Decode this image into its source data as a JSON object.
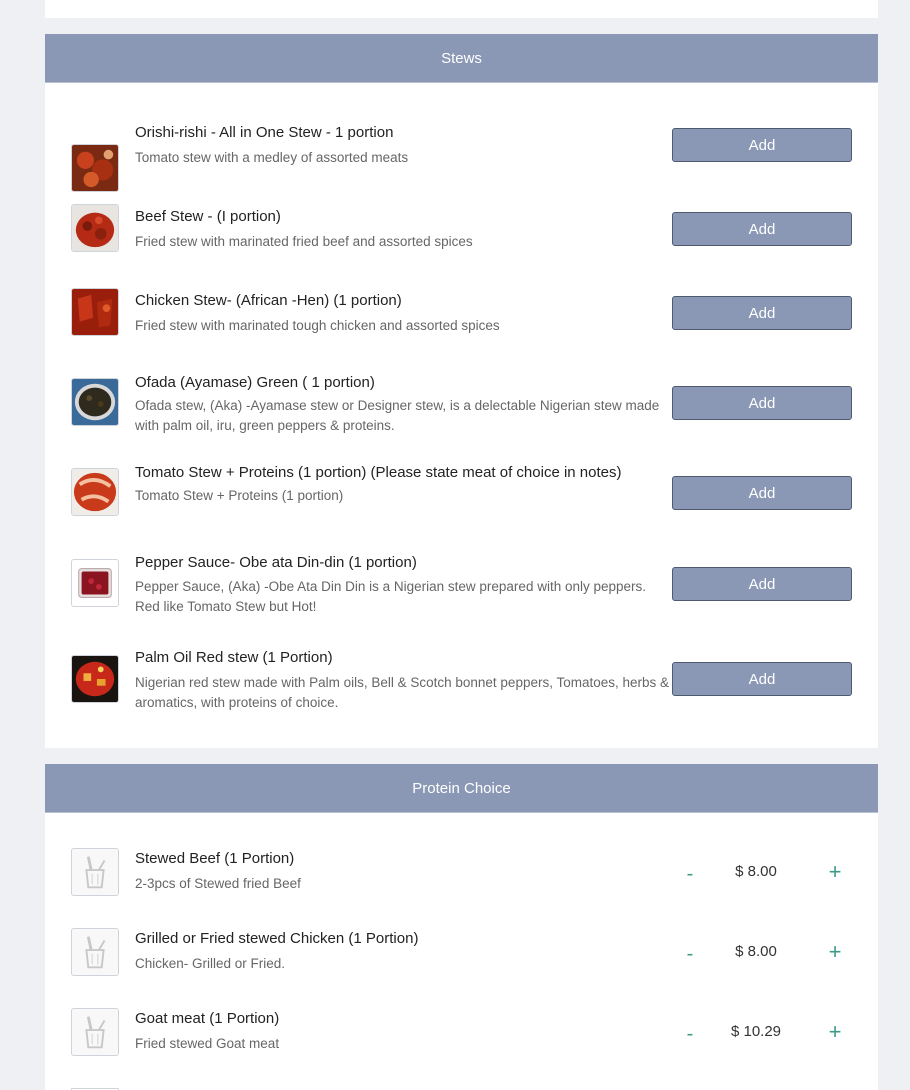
{
  "stews": {
    "header": "Stews",
    "items": [
      {
        "title": "Orishi-rishi - All in One Stew - 1 portion",
        "desc": "Tomato stew with a medley of assorted meats",
        "button": "Add"
      },
      {
        "title": "Beef Stew - (I portion)",
        "desc": "Fried stew with marinated fried beef and assorted spices",
        "button": "Add"
      },
      {
        "title": "Chicken Stew- (African -Hen) (1 portion)",
        "desc": "Fried stew with marinated tough chicken and assorted spices",
        "button": "Add"
      },
      {
        "title": "Ofada (Ayamase) Green ( 1 portion)",
        "desc": "Ofada stew, (Aka) -Ayamase stew or Designer stew, is a delectable Nigerian stew made with palm oil, iru, green peppers & proteins.",
        "button": "Add"
      },
      {
        "title": "Tomato Stew + Proteins (1 portion) (Please state meat of choice in notes)",
        "desc": "Tomato Stew + Proteins (1 portion)",
        "button": "Add"
      },
      {
        "title": "Pepper Sauce- Obe ata Din-din (1 portion)",
        "desc": "Pepper Sauce, (Aka) -Obe Ata Din Din is a Nigerian stew prepared with only peppers. Red like Tomato Stew but Hot!",
        "button": "Add"
      },
      {
        "title": "Palm Oil Red stew (1 Portion)",
        "desc": "Nigerian red stew made with Palm oils, Bell & Scotch bonnet peppers, Tomatoes, herbs & aromatics, with proteins of choice.",
        "button": "Add"
      }
    ]
  },
  "proteins": {
    "header": "Protein Choice",
    "items": [
      {
        "title": "Stewed Beef (1 Portion)",
        "desc": "2-3pcs of Stewed fried Beef",
        "price": "$ 8.00",
        "minus": "-",
        "plus": "+"
      },
      {
        "title": "Grilled or Fried stewed Chicken (1 Portion)",
        "desc": "Chicken- Grilled or Fried.",
        "price": "$ 8.00",
        "minus": "-",
        "plus": "+"
      },
      {
        "title": "Goat meat (1 Portion)",
        "desc": "Fried stewed Goat meat",
        "price": "$ 10.29",
        "minus": "-",
        "plus": "+"
      }
    ]
  },
  "colors": {
    "header_bg": "#8a98b6",
    "accent": "#3d9a86"
  },
  "icons": {
    "protein_placeholder": "basket-icon"
  }
}
